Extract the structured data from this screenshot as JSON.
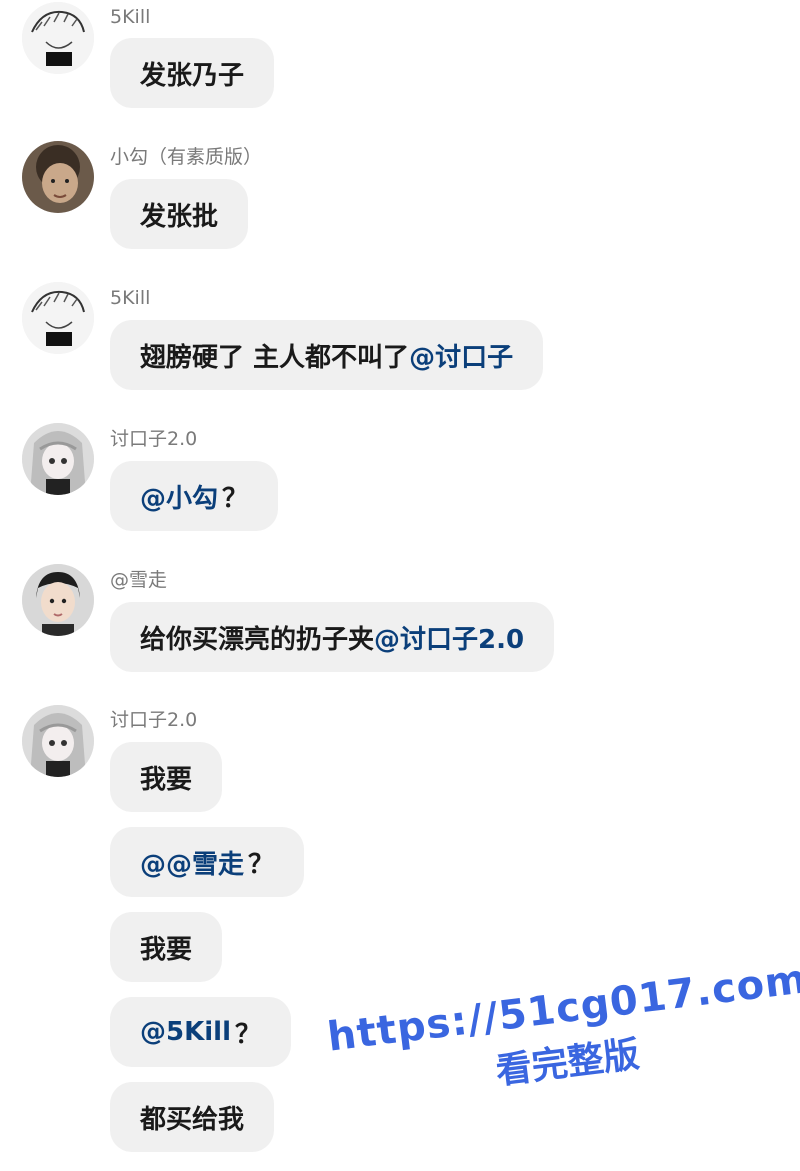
{
  "messages": [
    {
      "author": "5Kill",
      "text": "发张乃子",
      "mention": "",
      "suffix": ""
    },
    {
      "author": "小勾（有素质版）",
      "text": "发张批",
      "mention": "",
      "suffix": ""
    },
    {
      "author": "5Kill",
      "text": "翅膀硬了 主人都不叫了",
      "mention": "@讨口子",
      "suffix": ""
    },
    {
      "author": "讨口子2.0",
      "text": "",
      "mention": "@小勾",
      "suffix": "？"
    },
    {
      "author": "@雪走",
      "text": "给你买漂亮的扔子夹",
      "mention": "@讨口子2.0",
      "suffix": ""
    },
    {
      "author": "讨口子2.0",
      "text": "我要",
      "mention": "",
      "suffix": ""
    },
    {
      "author": "",
      "text": "",
      "mention": "@@雪走",
      "suffix": "？"
    },
    {
      "author": "",
      "text": "我要",
      "mention": "",
      "suffix": ""
    },
    {
      "author": "",
      "text": "",
      "mention": "@5Kill",
      "suffix": "？"
    },
    {
      "author": "",
      "text": "都买给我",
      "mention": "",
      "suffix": ""
    }
  ],
  "watermark": {
    "url": "https://51cg017.com",
    "subtitle": "看完整版"
  },
  "colors": {
    "mention": "#0b3f7a",
    "bubble": "#f0f0f0",
    "watermark": "#3a66e0"
  }
}
